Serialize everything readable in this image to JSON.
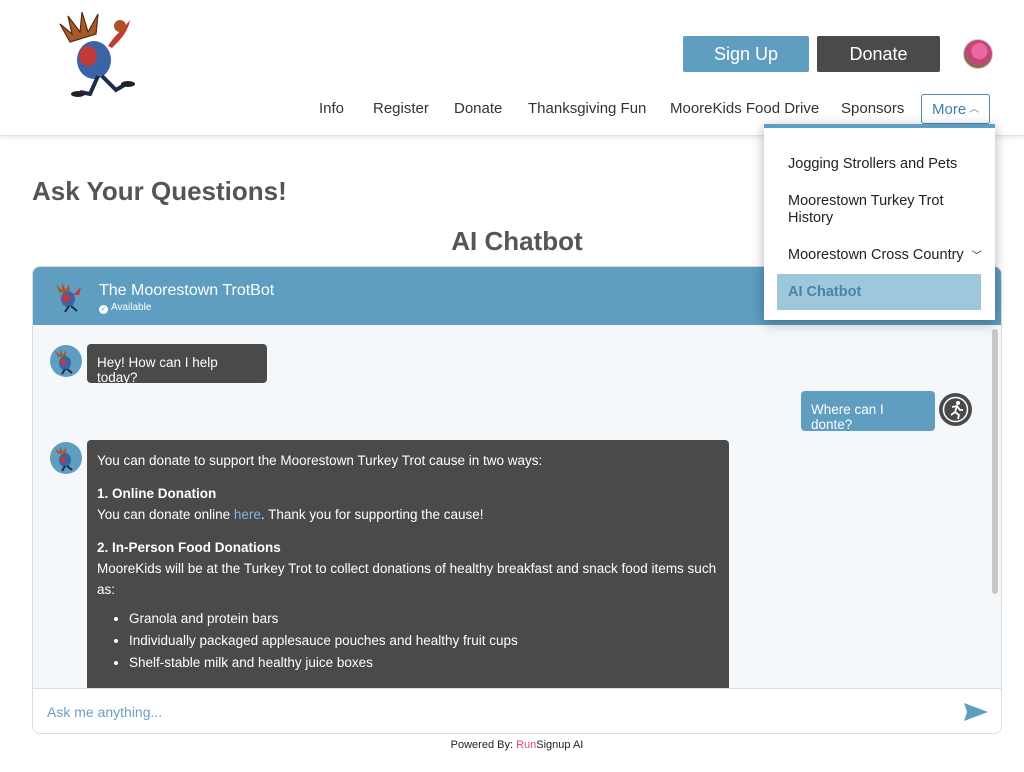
{
  "header": {
    "sign_up_label": "Sign Up",
    "donate_label": "Donate",
    "nav": [
      "Info",
      "Register",
      "Donate",
      "Thanksgiving Fun",
      "MooreKids Food Drive",
      "Sponsors"
    ],
    "more_label": "More"
  },
  "dropdown": {
    "items": [
      "Jogging Strollers and Pets",
      "Moorestown Turkey Trot",
      "History",
      "Moorestown Cross Country",
      "AI Chatbot"
    ]
  },
  "page": {
    "title": "Ask Your Questions!",
    "chat_heading": "AI Chatbot"
  },
  "chat": {
    "bot_name": "The Moorestown TrotBot",
    "status": "Available",
    "messages": {
      "bot_greeting": "Hey! How can I help today?",
      "user_question": "Where can I donte?",
      "answer_intro": "You can donate to support the Moorestown Turkey Trot cause in two ways:",
      "option1_title": "1. Online Donation",
      "option1_pre": "You can donate online ",
      "option1_link": "here",
      "option1_post": ". Thank you for supporting the cause!",
      "option2_title": "2. In-Person Food Donations",
      "option2_text": "MooreKids will be at the Turkey Trot to collect donations of healthy breakfast and snack food items such as:",
      "list": [
        "Granola and protein bars",
        "Individually packaged applesauce pouches and healthy fruit cups",
        "Shelf-stable milk and healthy juice boxes"
      ]
    },
    "input_placeholder": "Ask me anything...",
    "powered_prefix": "Powered By: ",
    "powered_run": "Run",
    "powered_rest": "Signup AI"
  },
  "colors": {
    "accent_blue": "#5f9dc1",
    "dark_gray": "#4a4a4a",
    "brand_pink": "#e0457b"
  }
}
